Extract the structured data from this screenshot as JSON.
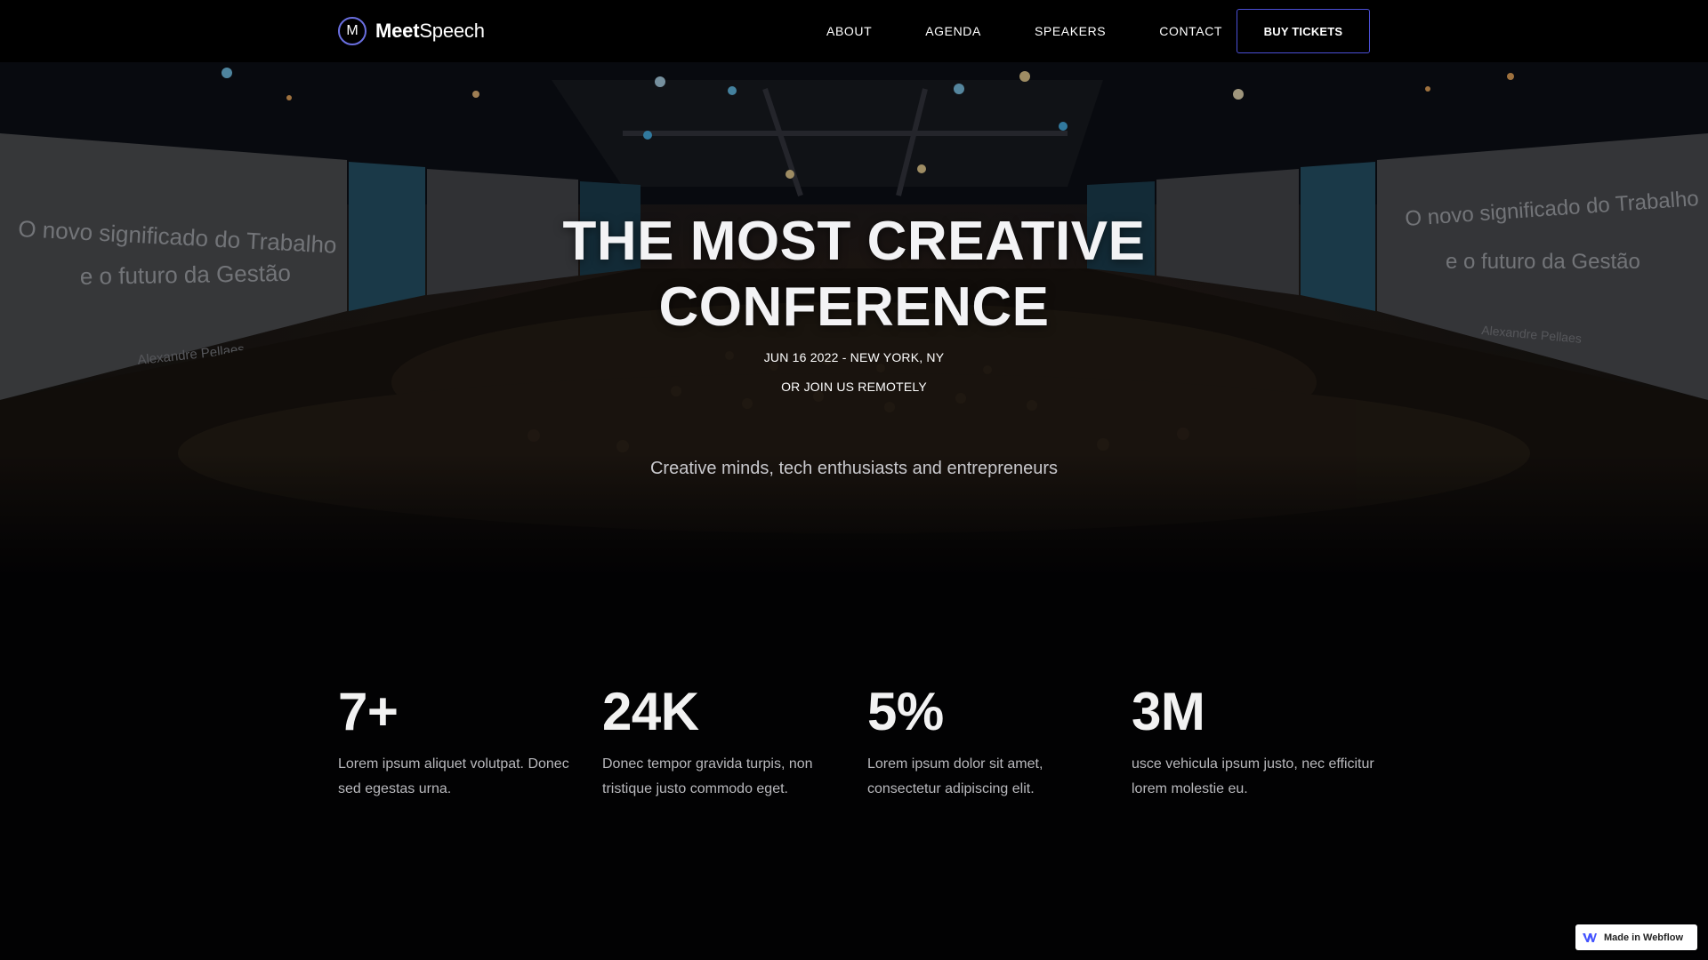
{
  "brand": {
    "mark": "M",
    "name_bold": "Meet",
    "name_regular": "Speech"
  },
  "nav": {
    "items": [
      {
        "label": "ABOUT"
      },
      {
        "label": "AGENDA"
      },
      {
        "label": "SPEAKERS"
      },
      {
        "label": "CONTACT"
      }
    ],
    "cta": "BUY TICKETS"
  },
  "hero": {
    "title_line1": "THE MOST CREATIVE",
    "title_line2": "CONFERENCE",
    "date_location": "JUN 16 2022 - NEW YORK, NY",
    "remote": "OR JOIN US REMOTELY",
    "tagline": "Creative minds, tech enthusiasts and entrepreneurs",
    "screen_text_line1": "O novo significado do Trabalho",
    "screen_text_line2": "e o futuro da Gestão",
    "screen_text_name": "Alexandre Pellaes"
  },
  "stats": [
    {
      "value": "7+",
      "description": "Lorem ipsum aliquet volutpat. Donec sed egestas urna."
    },
    {
      "value": "24K",
      "description": "Donec tempor gravida turpis, non tristique justo commodo eget."
    },
    {
      "value": "5%",
      "description": "Lorem ipsum dolor sit amet, consectetur adipiscing elit."
    },
    {
      "value": "3M",
      "description": "usce vehicula ipsum justo, nec efficitur lorem molestie eu."
    }
  ],
  "badge": {
    "icon": "webflow-logo-icon",
    "label": "Made in Webflow"
  },
  "colors": {
    "accent": "#4b4fd6",
    "background": "#020203",
    "text": "#ffffff",
    "muted": "#b8b8bc"
  }
}
